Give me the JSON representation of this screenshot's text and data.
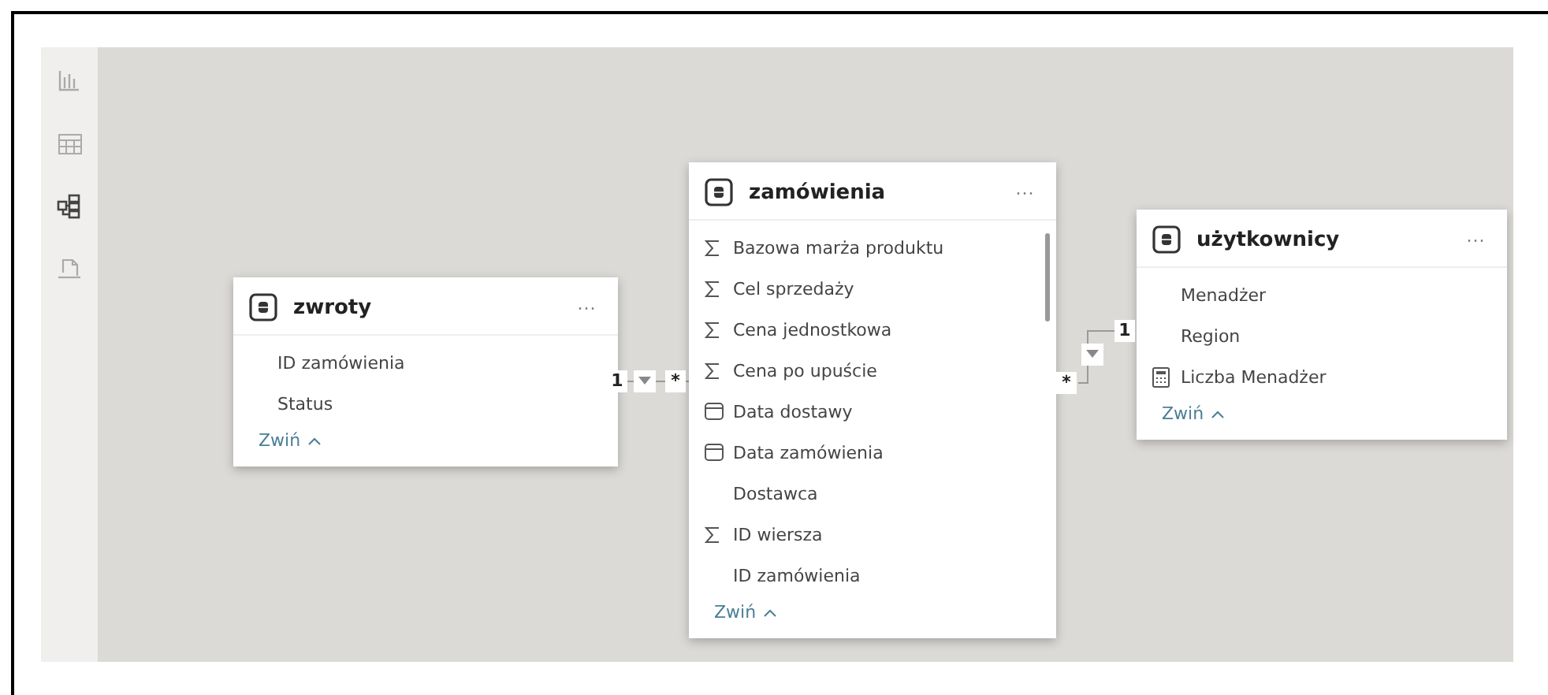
{
  "sidebar": {
    "items": [
      {
        "selected": false
      },
      {
        "selected": false
      },
      {
        "selected": true
      },
      {
        "selected": false
      }
    ]
  },
  "tables": [
    {
      "title": "zwroty",
      "more": "···",
      "collapse": "Zwiń",
      "scrollable": false,
      "fields": [
        {
          "kind": "plain",
          "name": "ID zamówienia"
        },
        {
          "kind": "plain",
          "name": "Status"
        }
      ]
    },
    {
      "title": "zamówienia",
      "more": "···",
      "collapse": "Zwiń",
      "scrollable": true,
      "fields": [
        {
          "kind": "sum",
          "name": "Bazowa marża produktu"
        },
        {
          "kind": "sum",
          "name": "Cel sprzedaży"
        },
        {
          "kind": "sum",
          "name": "Cena jednostkowa"
        },
        {
          "kind": "sum",
          "name": "Cena po upuście"
        },
        {
          "kind": "date",
          "name": "Data dostawy"
        },
        {
          "kind": "date",
          "name": "Data zamówienia"
        },
        {
          "kind": "plain",
          "name": "Dostawca"
        },
        {
          "kind": "sum",
          "name": "ID wiersza"
        },
        {
          "kind": "plain",
          "name": "ID zamówienia"
        }
      ]
    },
    {
      "title": "użytkownicy",
      "more": "···",
      "collapse": "Zwiń",
      "scrollable": false,
      "fields": [
        {
          "kind": "plain",
          "name": "Menadżer"
        },
        {
          "kind": "plain",
          "name": "Region"
        },
        {
          "kind": "measure",
          "name": "Liczba Menadżer"
        }
      ]
    }
  ],
  "relationships": [
    {
      "one": "1",
      "many": "*"
    },
    {
      "one": "1",
      "many": "*"
    }
  ]
}
